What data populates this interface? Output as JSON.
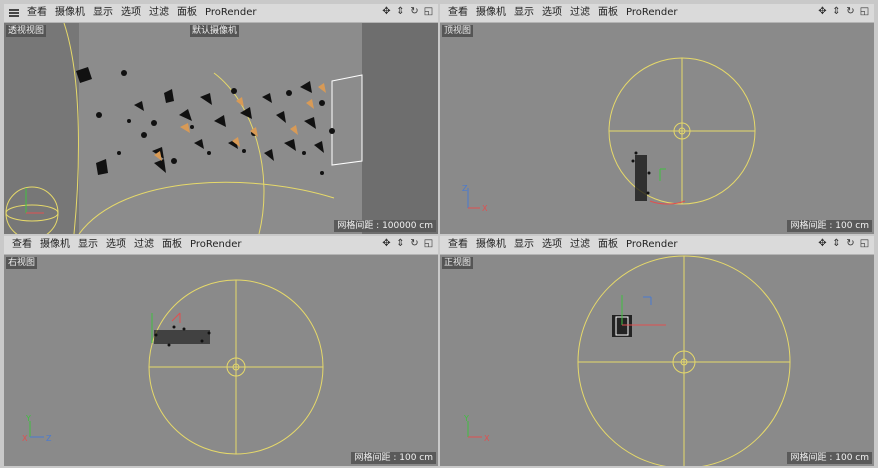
{
  "menu": {
    "items": [
      "查看",
      "摄像机",
      "显示",
      "选项",
      "过滤",
      "面板",
      "ProRender"
    ]
  },
  "viewports": {
    "perspective": {
      "label": "透视视图",
      "camera": "默认摄像机",
      "grid": "网格间距 : 100000 cm"
    },
    "top": {
      "label": "顶视图",
      "grid": "网格间距 : 100 cm"
    },
    "right": {
      "label": "右视图",
      "grid": "网格间距 : 100 cm"
    },
    "front": {
      "label": "正视图",
      "grid": "网格间距 : 100 cm"
    }
  },
  "icons": [
    "move-view-icon",
    "scale-view-icon",
    "rotate-view-icon",
    "maximize-view-icon"
  ],
  "colors": {
    "accent": "#e6d96a",
    "x_axis": "#e05050",
    "y_axis": "#40c040",
    "z_axis": "#4a7ad0"
  }
}
